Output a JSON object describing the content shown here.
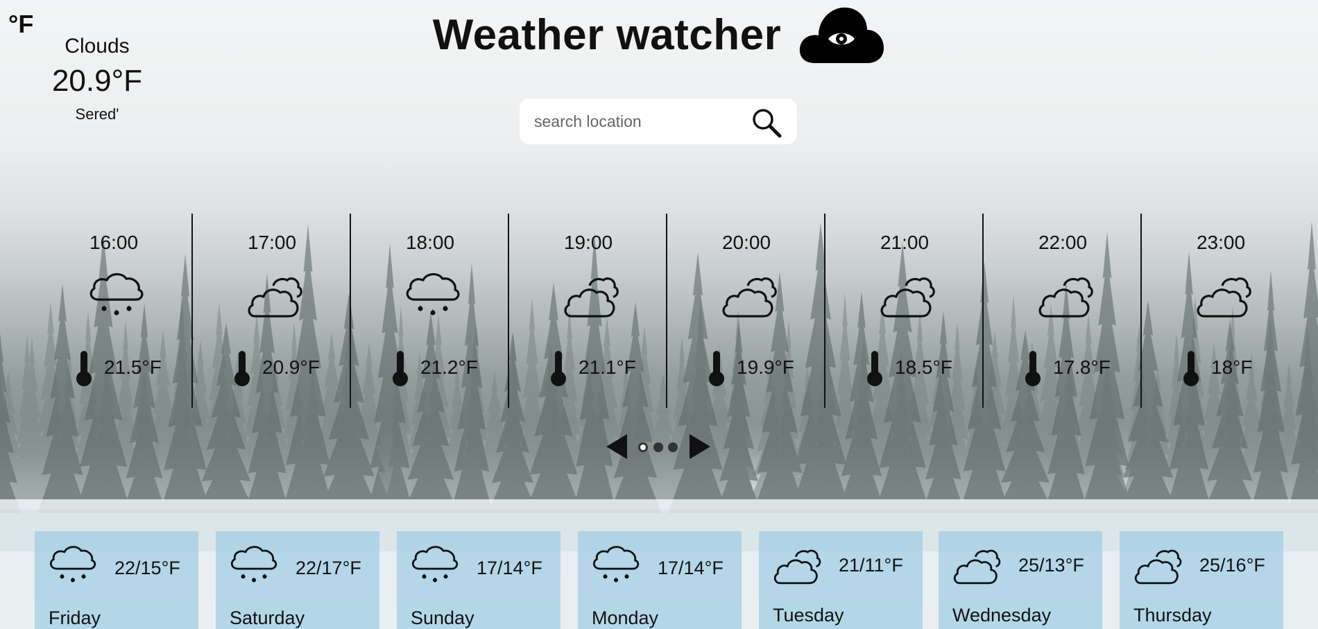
{
  "unit_toggle": "°F",
  "current": {
    "condition": "Clouds",
    "temperature": "20.9°F",
    "city": "Sered'"
  },
  "header": {
    "title": "Weather watcher",
    "logo_icon": "cloud-eye-icon"
  },
  "search": {
    "placeholder": "search location",
    "icon": "magnifier-icon"
  },
  "hourly": [
    {
      "time": "16:00",
      "icon": "rain-cloud-icon",
      "temp": "21.5°F"
    },
    {
      "time": "17:00",
      "icon": "cloud-icon",
      "temp": "20.9°F"
    },
    {
      "time": "18:00",
      "icon": "rain-cloud-icon",
      "temp": "21.2°F"
    },
    {
      "time": "19:00",
      "icon": "cloud-icon",
      "temp": "21.1°F"
    },
    {
      "time": "20:00",
      "icon": "cloud-icon",
      "temp": "19.9°F"
    },
    {
      "time": "21:00",
      "icon": "cloud-icon",
      "temp": "18.5°F"
    },
    {
      "time": "22:00",
      "icon": "cloud-icon",
      "temp": "17.8°F"
    },
    {
      "time": "23:00",
      "icon": "cloud-icon",
      "temp": "18°F"
    }
  ],
  "pager": {
    "pages": 3,
    "active_page": 1,
    "prev_icon": "triangle-left-icon",
    "next_icon": "triangle-right-icon"
  },
  "daily": [
    {
      "day": "Friday",
      "icon": "rain-cloud-icon",
      "range": "22/15°F"
    },
    {
      "day": "Saturday",
      "icon": "rain-cloud-icon",
      "range": "22/17°F"
    },
    {
      "day": "Sunday",
      "icon": "rain-cloud-icon",
      "range": "17/14°F"
    },
    {
      "day": "Monday",
      "icon": "rain-cloud-icon",
      "range": "17/14°F"
    },
    {
      "day": "Tuesday",
      "icon": "cloud-icon",
      "range": "21/11°F"
    },
    {
      "day": "Wednesday",
      "icon": "cloud-icon",
      "range": "25/13°F"
    },
    {
      "day": "Thursday",
      "icon": "cloud-icon",
      "range": "25/16°F"
    }
  ],
  "colors": {
    "day_card": "#a0cde4",
    "text": "#111111"
  }
}
